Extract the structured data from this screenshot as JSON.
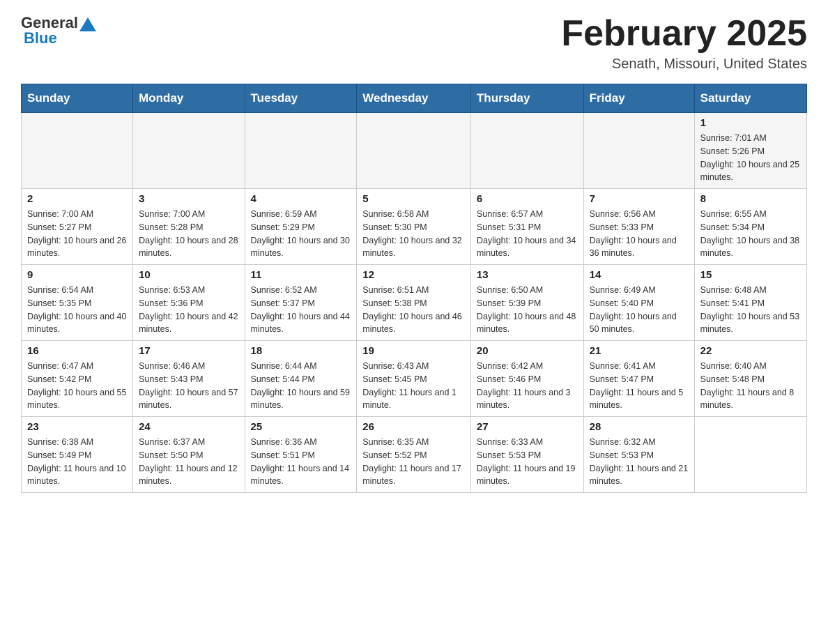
{
  "header": {
    "logo_general": "General",
    "logo_blue": "Blue",
    "month_title": "February 2025",
    "location": "Senath, Missouri, United States"
  },
  "weekdays": [
    "Sunday",
    "Monday",
    "Tuesday",
    "Wednesday",
    "Thursday",
    "Friday",
    "Saturday"
  ],
  "weeks": [
    {
      "days": [
        {
          "num": "",
          "info": ""
        },
        {
          "num": "",
          "info": ""
        },
        {
          "num": "",
          "info": ""
        },
        {
          "num": "",
          "info": ""
        },
        {
          "num": "",
          "info": ""
        },
        {
          "num": "",
          "info": ""
        },
        {
          "num": "1",
          "info": "Sunrise: 7:01 AM\nSunset: 5:26 PM\nDaylight: 10 hours and 25 minutes."
        }
      ]
    },
    {
      "days": [
        {
          "num": "2",
          "info": "Sunrise: 7:00 AM\nSunset: 5:27 PM\nDaylight: 10 hours and 26 minutes."
        },
        {
          "num": "3",
          "info": "Sunrise: 7:00 AM\nSunset: 5:28 PM\nDaylight: 10 hours and 28 minutes."
        },
        {
          "num": "4",
          "info": "Sunrise: 6:59 AM\nSunset: 5:29 PM\nDaylight: 10 hours and 30 minutes."
        },
        {
          "num": "5",
          "info": "Sunrise: 6:58 AM\nSunset: 5:30 PM\nDaylight: 10 hours and 32 minutes."
        },
        {
          "num": "6",
          "info": "Sunrise: 6:57 AM\nSunset: 5:31 PM\nDaylight: 10 hours and 34 minutes."
        },
        {
          "num": "7",
          "info": "Sunrise: 6:56 AM\nSunset: 5:33 PM\nDaylight: 10 hours and 36 minutes."
        },
        {
          "num": "8",
          "info": "Sunrise: 6:55 AM\nSunset: 5:34 PM\nDaylight: 10 hours and 38 minutes."
        }
      ]
    },
    {
      "days": [
        {
          "num": "9",
          "info": "Sunrise: 6:54 AM\nSunset: 5:35 PM\nDaylight: 10 hours and 40 minutes."
        },
        {
          "num": "10",
          "info": "Sunrise: 6:53 AM\nSunset: 5:36 PM\nDaylight: 10 hours and 42 minutes."
        },
        {
          "num": "11",
          "info": "Sunrise: 6:52 AM\nSunset: 5:37 PM\nDaylight: 10 hours and 44 minutes."
        },
        {
          "num": "12",
          "info": "Sunrise: 6:51 AM\nSunset: 5:38 PM\nDaylight: 10 hours and 46 minutes."
        },
        {
          "num": "13",
          "info": "Sunrise: 6:50 AM\nSunset: 5:39 PM\nDaylight: 10 hours and 48 minutes."
        },
        {
          "num": "14",
          "info": "Sunrise: 6:49 AM\nSunset: 5:40 PM\nDaylight: 10 hours and 50 minutes."
        },
        {
          "num": "15",
          "info": "Sunrise: 6:48 AM\nSunset: 5:41 PM\nDaylight: 10 hours and 53 minutes."
        }
      ]
    },
    {
      "days": [
        {
          "num": "16",
          "info": "Sunrise: 6:47 AM\nSunset: 5:42 PM\nDaylight: 10 hours and 55 minutes."
        },
        {
          "num": "17",
          "info": "Sunrise: 6:46 AM\nSunset: 5:43 PM\nDaylight: 10 hours and 57 minutes."
        },
        {
          "num": "18",
          "info": "Sunrise: 6:44 AM\nSunset: 5:44 PM\nDaylight: 10 hours and 59 minutes."
        },
        {
          "num": "19",
          "info": "Sunrise: 6:43 AM\nSunset: 5:45 PM\nDaylight: 11 hours and 1 minute."
        },
        {
          "num": "20",
          "info": "Sunrise: 6:42 AM\nSunset: 5:46 PM\nDaylight: 11 hours and 3 minutes."
        },
        {
          "num": "21",
          "info": "Sunrise: 6:41 AM\nSunset: 5:47 PM\nDaylight: 11 hours and 5 minutes."
        },
        {
          "num": "22",
          "info": "Sunrise: 6:40 AM\nSunset: 5:48 PM\nDaylight: 11 hours and 8 minutes."
        }
      ]
    },
    {
      "days": [
        {
          "num": "23",
          "info": "Sunrise: 6:38 AM\nSunset: 5:49 PM\nDaylight: 11 hours and 10 minutes."
        },
        {
          "num": "24",
          "info": "Sunrise: 6:37 AM\nSunset: 5:50 PM\nDaylight: 11 hours and 12 minutes."
        },
        {
          "num": "25",
          "info": "Sunrise: 6:36 AM\nSunset: 5:51 PM\nDaylight: 11 hours and 14 minutes."
        },
        {
          "num": "26",
          "info": "Sunrise: 6:35 AM\nSunset: 5:52 PM\nDaylight: 11 hours and 17 minutes."
        },
        {
          "num": "27",
          "info": "Sunrise: 6:33 AM\nSunset: 5:53 PM\nDaylight: 11 hours and 19 minutes."
        },
        {
          "num": "28",
          "info": "Sunrise: 6:32 AM\nSunset: 5:53 PM\nDaylight: 11 hours and 21 minutes."
        },
        {
          "num": "",
          "info": ""
        }
      ]
    }
  ]
}
